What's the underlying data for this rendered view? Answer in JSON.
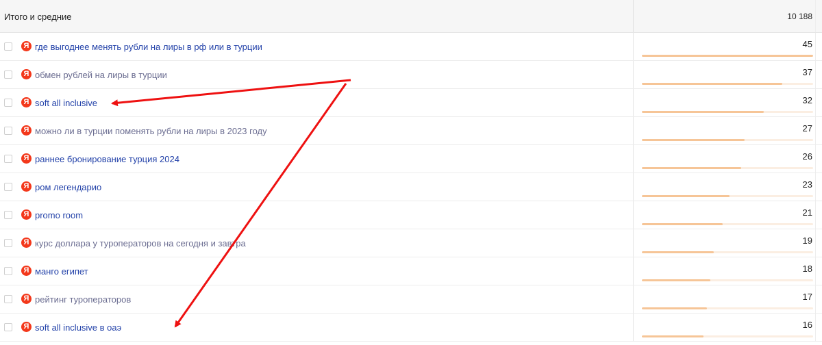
{
  "header": {
    "label": "Итого и средние",
    "total": "10 188"
  },
  "rows": [
    {
      "query": "где выгоднее менять рубли на лиры в рф или в турции",
      "value": "45",
      "share": 1.0,
      "visited": false
    },
    {
      "query": "обмен рублей на лиры в турции",
      "value": "37",
      "share": 0.82,
      "visited": true
    },
    {
      "query": "soft all inclusive",
      "value": "32",
      "share": 0.71,
      "visited": false
    },
    {
      "query": "можно ли в турции поменять рубли на лиры в 2023 году",
      "value": "27",
      "share": 0.6,
      "visited": true
    },
    {
      "query": "раннее бронирование турция 2024",
      "value": "26",
      "share": 0.58,
      "visited": false
    },
    {
      "query": "ром легендарио",
      "value": "23",
      "share": 0.51,
      "visited": false
    },
    {
      "query": "promo room",
      "value": "21",
      "share": 0.47,
      "visited": false
    },
    {
      "query": "курс доллара у туроператоров на сегодня и завтра",
      "value": "19",
      "share": 0.42,
      "visited": true
    },
    {
      "query": "манго египет",
      "value": "18",
      "share": 0.4,
      "visited": false
    },
    {
      "query": "рейтинг туроператоров",
      "value": "17",
      "share": 0.38,
      "visited": true
    },
    {
      "query": "soft all inclusive в оаэ",
      "value": "16",
      "share": 0.36,
      "visited": false
    }
  ],
  "icons": {
    "row_icon": "yandex-icon",
    "row_checkbox": "checkbox"
  },
  "colors": {
    "link": "#2342a9",
    "visited": "#6b6d91",
    "yandex": "#f3381b",
    "bar_fill": "#f6c597",
    "bar_track": "#fbeee2",
    "annotation_arrow": "#ee1111"
  }
}
